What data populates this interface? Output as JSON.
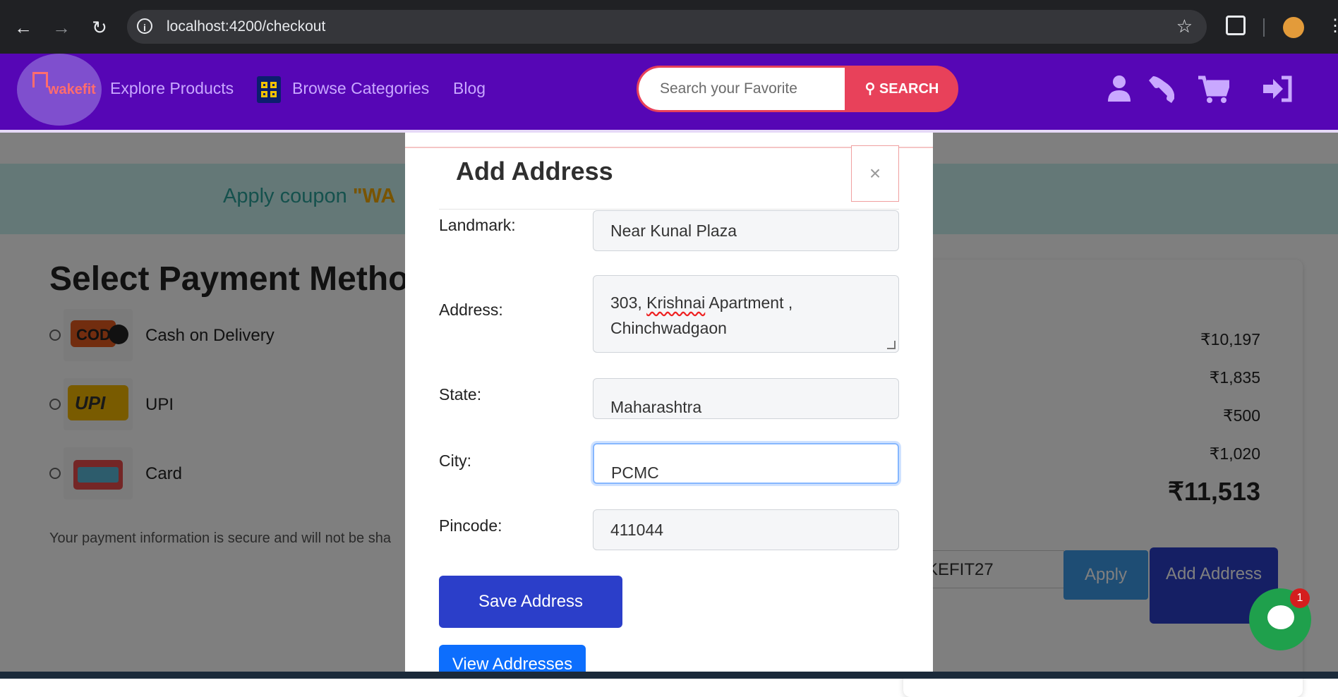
{
  "browser": {
    "url": "localhost:4200/checkout"
  },
  "header": {
    "logo_text": "wakefit",
    "nav": [
      "Explore Products",
      "Browse Categories",
      "Blog"
    ],
    "search_placeholder": "Search your Favorite",
    "search_button": "SEARCH",
    "icons": [
      "user-icon",
      "phone-icon",
      "cart-icon",
      "sign-in-icon"
    ]
  },
  "page": {
    "coupon_prefix": "Apply coupon ",
    "coupon_code_partial": "\"WA",
    "payment_title": "Select Payment Metho",
    "payment_options": [
      "Cash on Delivery",
      "UPI",
      "Card"
    ],
    "secure_note": "Your payment information is secure and will not be sha",
    "amounts": [
      "₹10,197",
      "₹1,835",
      "₹500",
      "₹1,020"
    ],
    "total": "₹11,513",
    "coupon_input_value": "KEFIT27",
    "apply_button": "Apply",
    "add_address_button": "Add Address"
  },
  "chat": {
    "badge_count": "1"
  },
  "modal": {
    "title": "Add Address",
    "close_label": "×",
    "fields": {
      "landmark": {
        "label": "Landmark:",
        "value": "Near Kunal Plaza"
      },
      "address": {
        "label": "Address:",
        "line1_a": "303, ",
        "line1_b": "Krishnai",
        "line1_c": " Apartment ,",
        "line2": "Chinchwadgaon"
      },
      "state": {
        "label": "State:",
        "value": "Maharashtra"
      },
      "city": {
        "label": "City:",
        "value": "PCMC"
      },
      "pincode": {
        "label": "Pincode:",
        "value": "411044"
      }
    },
    "save_button": "Save Address",
    "view_button": "View Addresses"
  }
}
